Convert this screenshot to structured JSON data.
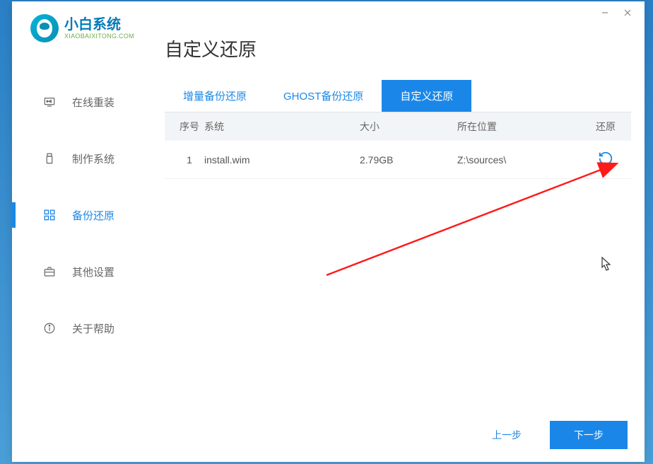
{
  "titlebar": {
    "min": "—",
    "close": "✕"
  },
  "logo": {
    "main": "小白系统",
    "sub": "XIAOBAIXITONG.COM"
  },
  "sidebar": {
    "items": [
      {
        "label": "在线重装",
        "icon": "monitor-icon"
      },
      {
        "label": "制作系统",
        "icon": "usb-icon"
      },
      {
        "label": "备份还原",
        "icon": "grid-icon",
        "active": true
      },
      {
        "label": "其他设置",
        "icon": "briefcase-icon"
      },
      {
        "label": "关于帮助",
        "icon": "info-icon"
      }
    ]
  },
  "page": {
    "title": "自定义还原"
  },
  "tabs": {
    "items": [
      {
        "label": "增量备份还原"
      },
      {
        "label": "GHOST备份还原"
      },
      {
        "label": "自定义还原",
        "active": true
      }
    ]
  },
  "table": {
    "headers": {
      "idx": "序号",
      "sys": "系统",
      "size": "大小",
      "loc": "所在位置",
      "act": "还原"
    },
    "rows": [
      {
        "idx": "1",
        "sys": "install.wim",
        "size": "2.79GB",
        "loc": "Z:\\sources\\"
      }
    ]
  },
  "footer": {
    "prev": "上一步",
    "next": "下一步"
  }
}
